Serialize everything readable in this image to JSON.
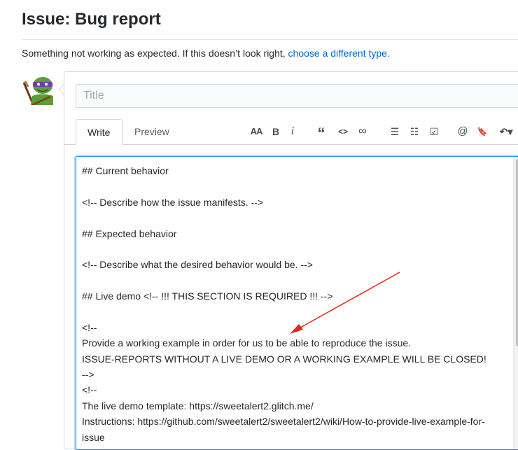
{
  "header": {
    "title": "Issue: Bug report",
    "subtitle_text": "Something not working as expected. If this doesn’t look right, ",
    "subtitle_link": "choose a different type."
  },
  "form": {
    "title_placeholder": "Title",
    "tabs": {
      "write": "Write",
      "preview": "Preview"
    },
    "toolbar": {
      "heading": "AA",
      "bold": "B",
      "italic": "i",
      "quote": "“",
      "code": "<>",
      "link": "∞",
      "bullet_list": "☰",
      "numbered_list": "☷",
      "task_list": "☑",
      "mention": "@",
      "reference": "🔖",
      "reply": "↶▾"
    },
    "editor_lines": [
      "## Current behavior",
      "",
      "<!-- Describe how the issue manifests. -->",
      "",
      "## Expected behavior",
      "",
      "<!-- Describe what the desired behavior would be. -->",
      "",
      "## Live demo <!-- !!! THIS SECTION IS REQUIRED !!! -->",
      "",
      "<!--",
      "Provide a working example in order for us to be able to reproduce the issue.",
      "ISSUE-REPORTS WITHOUT A LIVE DEMO OR A WORKING EXAMPLE WILL BE CLOSED!",
      "-->",
      "<!--",
      "The live demo template: https://sweetalert2.glitch.me/",
      "Instructions: https://github.com/sweetalert2/sweetalert2/wiki/How-to-provide-live-example-for-",
      "issue"
    ]
  },
  "colors": {
    "link": "#0366d6",
    "focus": "#2188ff",
    "annotation_arrow": "#e8251c"
  }
}
